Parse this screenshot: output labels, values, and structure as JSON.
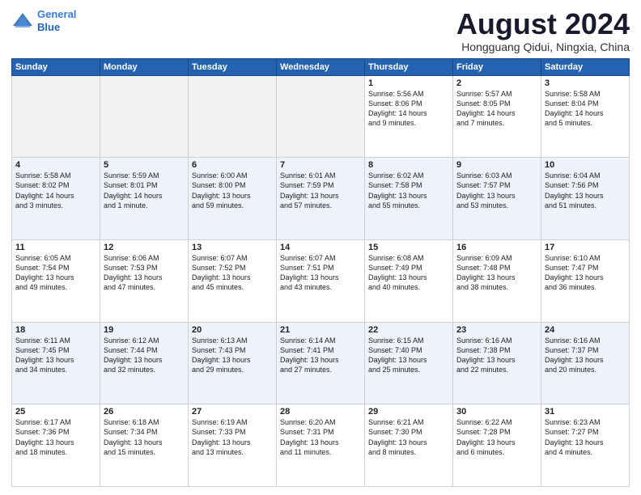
{
  "header": {
    "logo_line1": "General",
    "logo_line2": "Blue",
    "month": "August 2024",
    "location": "Hongguang Qidui, Ningxia, China"
  },
  "weekdays": [
    "Sunday",
    "Monday",
    "Tuesday",
    "Wednesday",
    "Thursday",
    "Friday",
    "Saturday"
  ],
  "rows": [
    [
      {
        "day": "",
        "info": ""
      },
      {
        "day": "",
        "info": ""
      },
      {
        "day": "",
        "info": ""
      },
      {
        "day": "",
        "info": ""
      },
      {
        "day": "1",
        "info": "Sunrise: 5:56 AM\nSunset: 8:06 PM\nDaylight: 14 hours\nand 9 minutes."
      },
      {
        "day": "2",
        "info": "Sunrise: 5:57 AM\nSunset: 8:05 PM\nDaylight: 14 hours\nand 7 minutes."
      },
      {
        "day": "3",
        "info": "Sunrise: 5:58 AM\nSunset: 8:04 PM\nDaylight: 14 hours\nand 5 minutes."
      }
    ],
    [
      {
        "day": "4",
        "info": "Sunrise: 5:58 AM\nSunset: 8:02 PM\nDaylight: 14 hours\nand 3 minutes."
      },
      {
        "day": "5",
        "info": "Sunrise: 5:59 AM\nSunset: 8:01 PM\nDaylight: 14 hours\nand 1 minute."
      },
      {
        "day": "6",
        "info": "Sunrise: 6:00 AM\nSunset: 8:00 PM\nDaylight: 13 hours\nand 59 minutes."
      },
      {
        "day": "7",
        "info": "Sunrise: 6:01 AM\nSunset: 7:59 PM\nDaylight: 13 hours\nand 57 minutes."
      },
      {
        "day": "8",
        "info": "Sunrise: 6:02 AM\nSunset: 7:58 PM\nDaylight: 13 hours\nand 55 minutes."
      },
      {
        "day": "9",
        "info": "Sunrise: 6:03 AM\nSunset: 7:57 PM\nDaylight: 13 hours\nand 53 minutes."
      },
      {
        "day": "10",
        "info": "Sunrise: 6:04 AM\nSunset: 7:56 PM\nDaylight: 13 hours\nand 51 minutes."
      }
    ],
    [
      {
        "day": "11",
        "info": "Sunrise: 6:05 AM\nSunset: 7:54 PM\nDaylight: 13 hours\nand 49 minutes."
      },
      {
        "day": "12",
        "info": "Sunrise: 6:06 AM\nSunset: 7:53 PM\nDaylight: 13 hours\nand 47 minutes."
      },
      {
        "day": "13",
        "info": "Sunrise: 6:07 AM\nSunset: 7:52 PM\nDaylight: 13 hours\nand 45 minutes."
      },
      {
        "day": "14",
        "info": "Sunrise: 6:07 AM\nSunset: 7:51 PM\nDaylight: 13 hours\nand 43 minutes."
      },
      {
        "day": "15",
        "info": "Sunrise: 6:08 AM\nSunset: 7:49 PM\nDaylight: 13 hours\nand 40 minutes."
      },
      {
        "day": "16",
        "info": "Sunrise: 6:09 AM\nSunset: 7:48 PM\nDaylight: 13 hours\nand 38 minutes."
      },
      {
        "day": "17",
        "info": "Sunrise: 6:10 AM\nSunset: 7:47 PM\nDaylight: 13 hours\nand 36 minutes."
      }
    ],
    [
      {
        "day": "18",
        "info": "Sunrise: 6:11 AM\nSunset: 7:45 PM\nDaylight: 13 hours\nand 34 minutes."
      },
      {
        "day": "19",
        "info": "Sunrise: 6:12 AM\nSunset: 7:44 PM\nDaylight: 13 hours\nand 32 minutes."
      },
      {
        "day": "20",
        "info": "Sunrise: 6:13 AM\nSunset: 7:43 PM\nDaylight: 13 hours\nand 29 minutes."
      },
      {
        "day": "21",
        "info": "Sunrise: 6:14 AM\nSunset: 7:41 PM\nDaylight: 13 hours\nand 27 minutes."
      },
      {
        "day": "22",
        "info": "Sunrise: 6:15 AM\nSunset: 7:40 PM\nDaylight: 13 hours\nand 25 minutes."
      },
      {
        "day": "23",
        "info": "Sunrise: 6:16 AM\nSunset: 7:38 PM\nDaylight: 13 hours\nand 22 minutes."
      },
      {
        "day": "24",
        "info": "Sunrise: 6:16 AM\nSunset: 7:37 PM\nDaylight: 13 hours\nand 20 minutes."
      }
    ],
    [
      {
        "day": "25",
        "info": "Sunrise: 6:17 AM\nSunset: 7:36 PM\nDaylight: 13 hours\nand 18 minutes."
      },
      {
        "day": "26",
        "info": "Sunrise: 6:18 AM\nSunset: 7:34 PM\nDaylight: 13 hours\nand 15 minutes."
      },
      {
        "day": "27",
        "info": "Sunrise: 6:19 AM\nSunset: 7:33 PM\nDaylight: 13 hours\nand 13 minutes."
      },
      {
        "day": "28",
        "info": "Sunrise: 6:20 AM\nSunset: 7:31 PM\nDaylight: 13 hours\nand 11 minutes."
      },
      {
        "day": "29",
        "info": "Sunrise: 6:21 AM\nSunset: 7:30 PM\nDaylight: 13 hours\nand 8 minutes."
      },
      {
        "day": "30",
        "info": "Sunrise: 6:22 AM\nSunset: 7:28 PM\nDaylight: 13 hours\nand 6 minutes."
      },
      {
        "day": "31",
        "info": "Sunrise: 6:23 AM\nSunset: 7:27 PM\nDaylight: 13 hours\nand 4 minutes."
      }
    ]
  ]
}
